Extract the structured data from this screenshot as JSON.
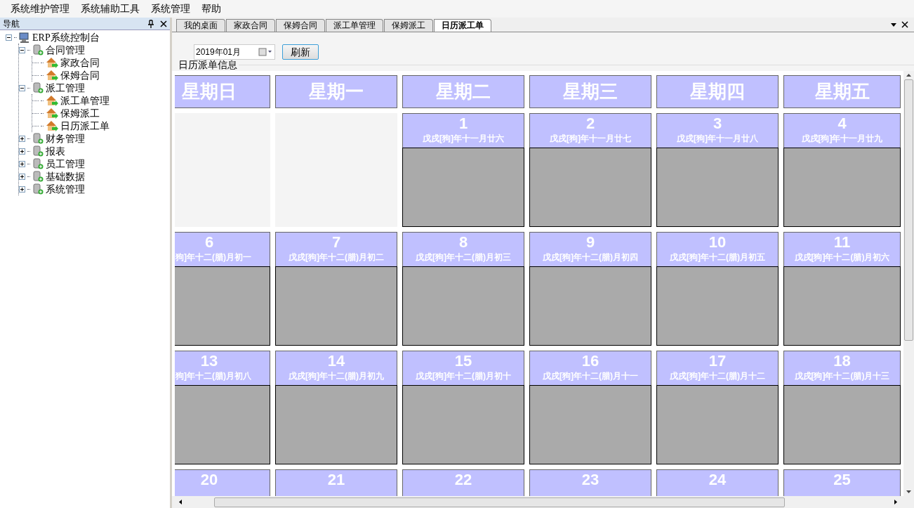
{
  "menu": [
    "系统维护管理",
    "系统辅助工具",
    "系统管理",
    "帮助"
  ],
  "nav": {
    "title": "导航",
    "tree": [
      {
        "label": "ERP系统控制台",
        "kind": "root",
        "expanded": true,
        "children": [
          {
            "label": "合同管理",
            "kind": "folder",
            "expanded": true,
            "children": [
              {
                "label": "家政合同",
                "kind": "page"
              },
              {
                "label": "保姆合同",
                "kind": "page"
              }
            ]
          },
          {
            "label": "派工管理",
            "kind": "folder",
            "expanded": true,
            "children": [
              {
                "label": "派工单管理",
                "kind": "page"
              },
              {
                "label": "保姆派工",
                "kind": "page"
              },
              {
                "label": "日历派工单",
                "kind": "page"
              }
            ]
          },
          {
            "label": "财务管理",
            "kind": "folder",
            "expanded": false
          },
          {
            "label": "报表",
            "kind": "folder",
            "expanded": false
          },
          {
            "label": "员工管理",
            "kind": "folder",
            "expanded": false
          },
          {
            "label": "基础数据",
            "kind": "folder",
            "expanded": false
          },
          {
            "label": "系统管理",
            "kind": "folder",
            "expanded": false
          }
        ]
      }
    ]
  },
  "tabs": [
    {
      "label": "我的桌面",
      "selected": false
    },
    {
      "label": "家政合同",
      "selected": false
    },
    {
      "label": "保姆合同",
      "selected": false
    },
    {
      "label": "派工单管理",
      "selected": false
    },
    {
      "label": "保姆派工",
      "selected": false
    },
    {
      "label": "日历派工单",
      "selected": true
    }
  ],
  "month_field": {
    "value": "2019年01月"
  },
  "refresh_button": "刷新",
  "group_title": "日历派单信息",
  "weekdays": [
    "星期日",
    "星期一",
    "星期二",
    "星期三",
    "星期四",
    "星期五"
  ],
  "weeks": [
    [
      {
        "kind": "empty"
      },
      {
        "kind": "empty"
      },
      {
        "kind": "day",
        "day": "1",
        "lunar": "戊戌[狗]年十一月廿六"
      },
      {
        "kind": "day",
        "day": "2",
        "lunar": "戊戌[狗]年十一月廿七"
      },
      {
        "kind": "day",
        "day": "3",
        "lunar": "戊戌[狗]年十一月廿八"
      },
      {
        "kind": "day",
        "day": "4",
        "lunar": "戊戌[狗]年十一月廿九"
      }
    ],
    [
      {
        "kind": "day",
        "day": "6",
        "lunar": "狗]年十二(腊)月初一"
      },
      {
        "kind": "day",
        "day": "7",
        "lunar": "戊戌[狗]年十二(腊)月初二"
      },
      {
        "kind": "day",
        "day": "8",
        "lunar": "戊戌[狗]年十二(腊)月初三"
      },
      {
        "kind": "day",
        "day": "9",
        "lunar": "戊戌[狗]年十二(腊)月初四"
      },
      {
        "kind": "day",
        "day": "10",
        "lunar": "戊戌[狗]年十二(腊)月初五"
      },
      {
        "kind": "day",
        "day": "11",
        "lunar": "戊戌[狗]年十二(腊)月初六"
      }
    ],
    [
      {
        "kind": "day",
        "day": "13",
        "lunar": "狗]年十二(腊)月初八"
      },
      {
        "kind": "day",
        "day": "14",
        "lunar": "戊戌[狗]年十二(腊)月初九"
      },
      {
        "kind": "day",
        "day": "15",
        "lunar": "戊戌[狗]年十二(腊)月初十"
      },
      {
        "kind": "day",
        "day": "16",
        "lunar": "戊戌[狗]年十二(腊)月十一"
      },
      {
        "kind": "day",
        "day": "17",
        "lunar": "戊戌[狗]年十二(腊)月十二"
      },
      {
        "kind": "day",
        "day": "18",
        "lunar": "戊戌[狗]年十二(腊)月十三"
      }
    ],
    [
      {
        "kind": "day",
        "day": "20"
      },
      {
        "kind": "day",
        "day": "21"
      },
      {
        "kind": "day",
        "day": "22"
      },
      {
        "kind": "day",
        "day": "23"
      },
      {
        "kind": "day",
        "day": "24"
      },
      {
        "kind": "day",
        "day": "25"
      }
    ]
  ]
}
